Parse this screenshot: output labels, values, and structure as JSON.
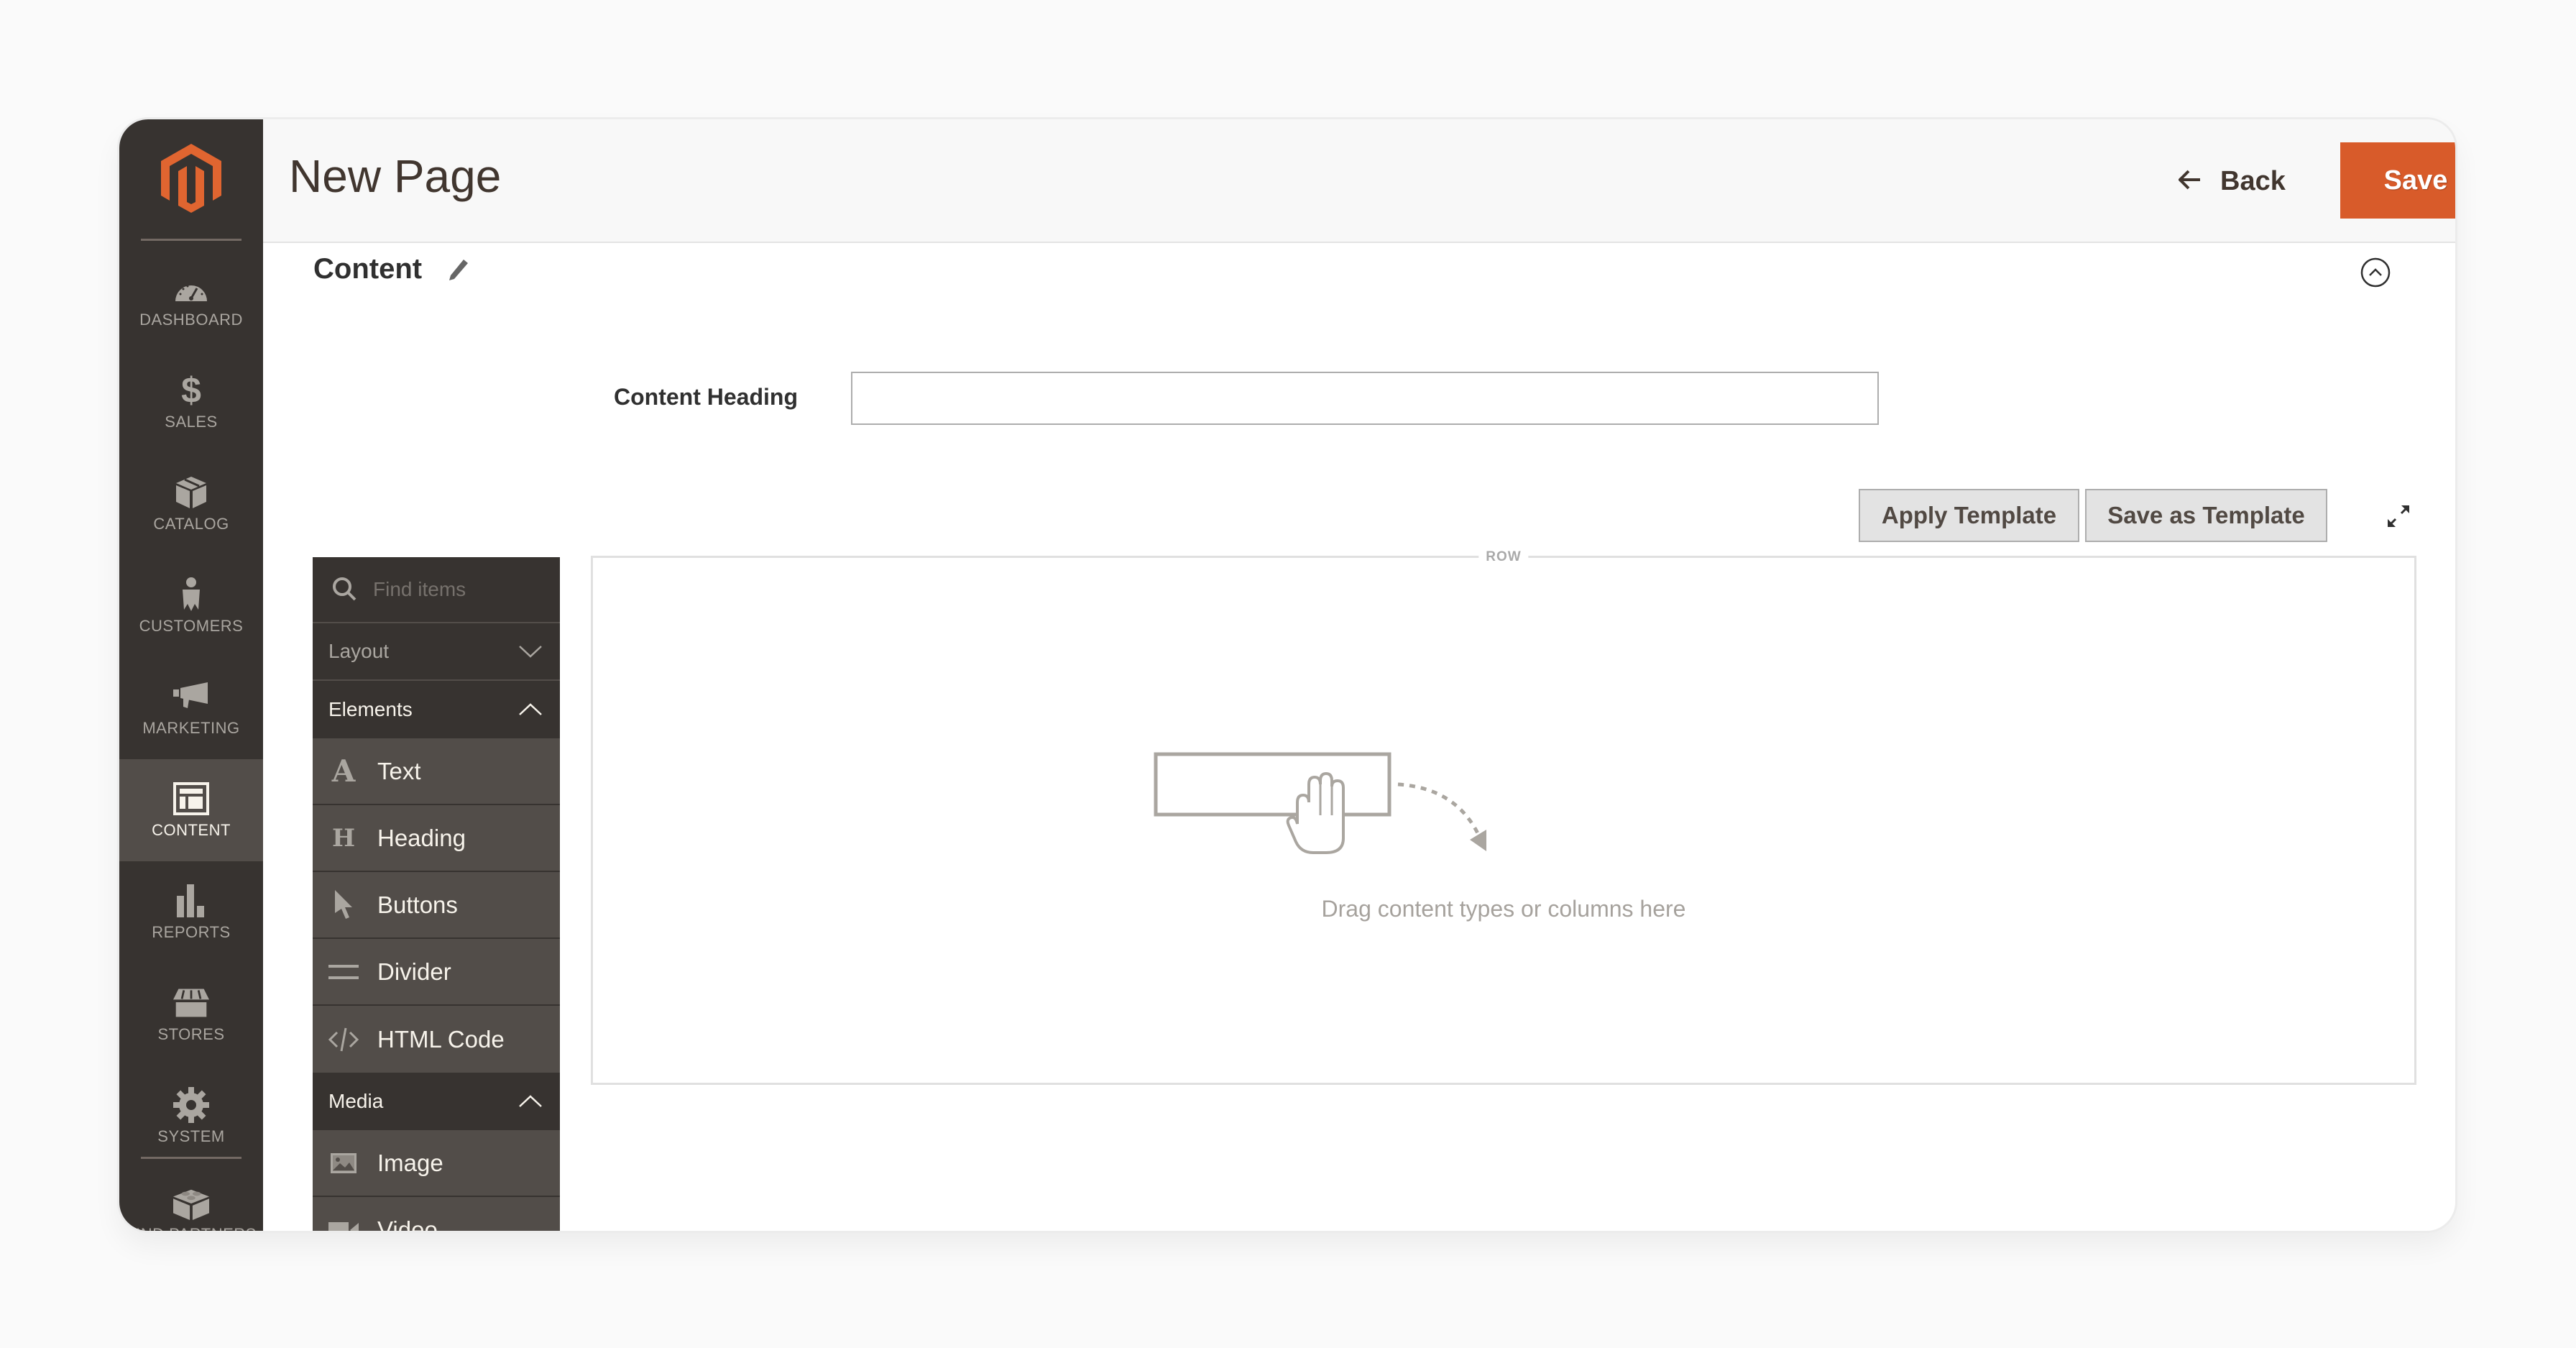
{
  "sidebar": {
    "logo": "magento-logo",
    "items": [
      {
        "label": "Dashboard",
        "icon": "dashboard-icon",
        "active": false
      },
      {
        "label": "Sales",
        "icon": "dollar-icon",
        "active": false
      },
      {
        "label": "Catalog",
        "icon": "box-icon",
        "active": false
      },
      {
        "label": "Customers",
        "icon": "person-icon",
        "active": false
      },
      {
        "label": "Marketing",
        "icon": "megaphone-icon",
        "active": false
      },
      {
        "label": "Content",
        "icon": "layout-icon",
        "active": true
      },
      {
        "label": "Reports",
        "icon": "bar-chart-icon",
        "active": false
      },
      {
        "label": "Stores",
        "icon": "storefront-icon",
        "active": false
      },
      {
        "label": "System",
        "icon": "gear-icon",
        "active": false
      },
      {
        "label": "Find Partners",
        "icon": "brick-icon",
        "active": false
      }
    ]
  },
  "header": {
    "title": "New Page",
    "back_label": "Back",
    "save_label": "Save"
  },
  "content_section": {
    "title": "Content",
    "heading_field": {
      "label": "Content Heading",
      "value": "",
      "placeholder": ""
    },
    "apply_template_label": "Apply Template",
    "save_template_label": "Save as Template"
  },
  "page_builder": {
    "search_placeholder": "Find items",
    "groups": [
      {
        "label": "Layout",
        "expanded": false,
        "items": []
      },
      {
        "label": "Elements",
        "expanded": true,
        "items": [
          {
            "label": "Text",
            "icon": "text-icon"
          },
          {
            "label": "Heading",
            "icon": "heading-icon"
          },
          {
            "label": "Buttons",
            "icon": "pointer-icon"
          },
          {
            "label": "Divider",
            "icon": "divider-icon"
          },
          {
            "label": "HTML Code",
            "icon": "code-icon"
          }
        ]
      },
      {
        "label": "Media",
        "expanded": true,
        "items": [
          {
            "label": "Image",
            "icon": "image-icon"
          },
          {
            "label": "Video",
            "icon": "video-icon"
          }
        ]
      }
    ],
    "stage": {
      "row_label": "ROW",
      "drop_hint": "Drag content types or columns here"
    }
  },
  "colors": {
    "accent": "#d85b2a",
    "sidebar_bg": "#373330",
    "sidebar_active": "#524d49"
  }
}
